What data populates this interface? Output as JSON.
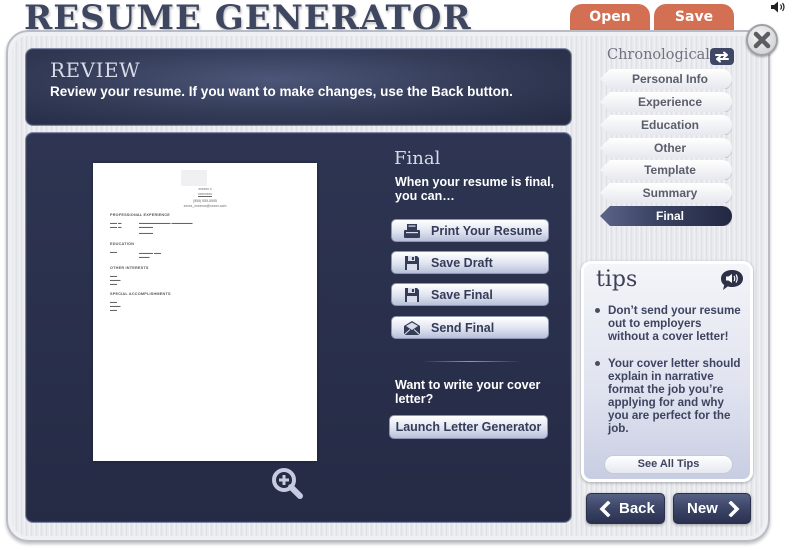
{
  "app": {
    "title": "RESUME GENERATOR"
  },
  "top_tabs": [
    {
      "label": "Open"
    },
    {
      "label": "Save"
    }
  ],
  "colors": {
    "accent_tab": "#d36f52",
    "panel_dark": "#2e3552",
    "title_text": "#3e4660"
  },
  "header": {
    "title": "REVIEW",
    "subtitle": "Review your resume. If you want to make changes, use the Back button."
  },
  "resume_preview": {
    "name_lines": [
      "xxxxxx x",
      "xxxxxxxx",
      "(555) 555-5555",
      "xxxxx_xxxxxxx@xxxxx.com"
    ],
    "sections": [
      {
        "heading": "PROFESSIONAL EXPERIENCE"
      },
      {
        "heading": "EDUCATION"
      },
      {
        "heading": "OTHER INTERESTS"
      },
      {
        "heading": "SPECIAL ACCOMPLISHMENTS"
      }
    ]
  },
  "final_panel": {
    "title": "Final",
    "description": "When your resume is final, you can…",
    "actions": [
      {
        "label": "Print Your Resume",
        "icon": "printer-icon"
      },
      {
        "label": "Save Draft",
        "icon": "floppy-disk-icon"
      },
      {
        "label": "Save Final",
        "icon": "floppy-disk-icon"
      },
      {
        "label": "Send Final",
        "icon": "envelope-icon"
      }
    ],
    "cover_letter_prompt": "Want to write your cover letter?",
    "launch_label": "Launch Letter Generator"
  },
  "sidebar": {
    "format_label": "Chronological",
    "steps": [
      {
        "label": "Personal Info",
        "active": false
      },
      {
        "label": "Experience",
        "active": false
      },
      {
        "label": "Education",
        "active": false
      },
      {
        "label": "Other",
        "active": false
      },
      {
        "label": "Template",
        "active": false
      },
      {
        "label": "Summary",
        "active": false
      },
      {
        "label": "Final",
        "active": true
      }
    ]
  },
  "tips": {
    "title": "tips",
    "items": [
      "Don’t send your resume out to employers without a cover letter!",
      "Your cover letter should explain in narrative format the job you’re applying for and why you are perfect for the job."
    ],
    "see_all_label": "See All Tips"
  },
  "nav": {
    "back_label": "Back",
    "new_label": "New"
  }
}
